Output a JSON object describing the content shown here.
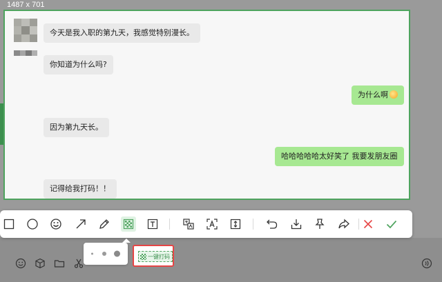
{
  "screen_size_label": "1487 x 701",
  "chat": {
    "messages": [
      {
        "side": "in",
        "text": "今天是我入职的第九天，我感觉特别漫长。"
      },
      {
        "side": "in",
        "text": "你知道为什么吗?"
      },
      {
        "side": "out",
        "text": "为什么啊"
      },
      {
        "side": "in",
        "text": "因为第九天长。"
      },
      {
        "side": "out",
        "text": "哈哈哈哈哈太好笑了 我要发朋友圈"
      },
      {
        "side": "in",
        "text": "记得给我打码！！"
      }
    ]
  },
  "toolbar": {
    "tools": [
      {
        "name": "rectangle-tool",
        "icon": "rectangle-icon"
      },
      {
        "name": "ellipse-tool",
        "icon": "circle-icon"
      },
      {
        "name": "emoji-tool",
        "icon": "smiley-icon"
      },
      {
        "name": "arrow-tool",
        "icon": "arrow-icon"
      },
      {
        "name": "pen-tool",
        "icon": "pencil-icon"
      },
      {
        "name": "mosaic-tool",
        "icon": "mosaic-icon",
        "selected": true
      },
      {
        "name": "text-tool",
        "icon": "text-icon"
      },
      {
        "name": "translate-tool",
        "icon": "translate-icon"
      },
      {
        "name": "ocr-tool",
        "icon": "ocr-icon"
      },
      {
        "name": "long-screenshot-tool",
        "icon": "scroll-capture-icon"
      },
      {
        "name": "undo-button",
        "icon": "undo-icon"
      },
      {
        "name": "save-button",
        "icon": "download-icon"
      },
      {
        "name": "pin-button",
        "icon": "pin-icon"
      },
      {
        "name": "share-button",
        "icon": "share-icon"
      },
      {
        "name": "cancel-button",
        "icon": "close-icon"
      },
      {
        "name": "done-button",
        "icon": "check-icon"
      }
    ]
  },
  "mosaic_panel": {
    "brush_sizes": [
      "small",
      "medium",
      "large"
    ],
    "one_key_label": "一键打码"
  },
  "input_bar": {
    "icons": [
      "emoji-icon",
      "box-icon",
      "folder-icon",
      "scissors-icon",
      "voice-icon"
    ]
  },
  "colors": {
    "accent_green": "#4ea35e",
    "outgoing_bubble": "#a7e892",
    "incoming_bubble": "#e9e9e9",
    "cancel_red": "#e64545",
    "highlight_border": "#e64545"
  }
}
